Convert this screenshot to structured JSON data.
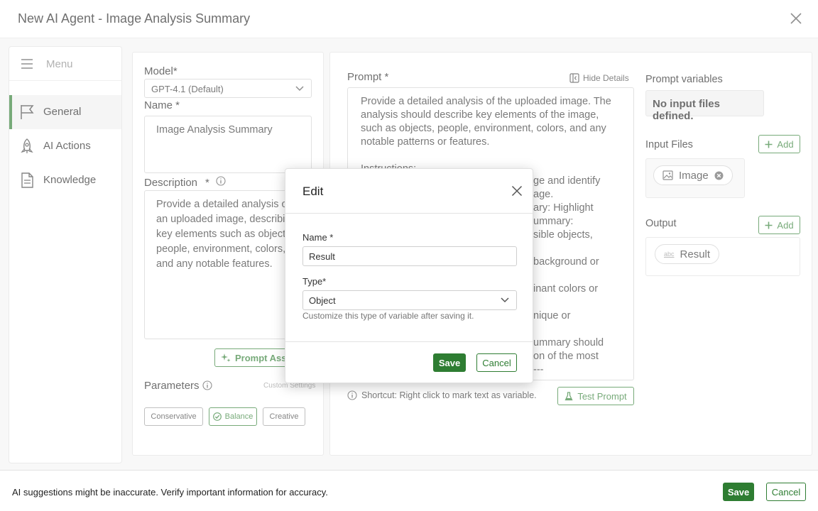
{
  "window": {
    "title": "New AI Agent - Image Analysis Summary"
  },
  "menu": {
    "label": "Menu",
    "items": [
      {
        "label": "General",
        "active": true
      },
      {
        "label": "AI Actions",
        "active": false
      },
      {
        "label": "Knowledge",
        "active": false
      }
    ]
  },
  "general": {
    "model_label": "Model*",
    "model_value": "GPT-4.1 (Default)",
    "name_label": "Name *",
    "name_value": "Image Analysis Summary",
    "description_label": "Description",
    "description_required": "*",
    "description_value": "Provide a detailed analysis of an uploaded image, describing key elements such as objects, people, environment, colors, and any notable features.",
    "prompt_assist_label": "Prompt Assi",
    "parameters_label": "Parameters",
    "custom_settings_label": "Custom Settings",
    "presets": [
      {
        "label": "Conservative",
        "selected": false
      },
      {
        "label": "Balance",
        "selected": true
      },
      {
        "label": "Creative",
        "selected": false
      }
    ]
  },
  "prompt": {
    "label": "Prompt *",
    "hide_details_label": "Hide Details",
    "paragraph1": "Provide a detailed analysis of the uploaded image. The analysis should describe key elements of the image, such as objects, people, environment, colors, and any notable patterns or features.",
    "instructions_heading": "Instructions:",
    "visible_fragments": [
      "ge and identify",
      "age.",
      "ary: Highlight",
      "ummary:",
      "sible objects,",
      "",
      "background or",
      "",
      "inant colors or",
      "",
      "nique or",
      "",
      "ummary should",
      "on of the most",
      "---"
    ],
    "shortcut_text": "Shortcut: Right click to mark text as variable.",
    "test_prompt_label": "Test Prompt"
  },
  "variables": {
    "label": "Prompt variables",
    "empty_text": "No input files defined."
  },
  "input_files": {
    "label": "Input Files",
    "add_label": "Add",
    "items": [
      {
        "label": "Image"
      }
    ]
  },
  "output": {
    "label": "Output",
    "add_label": "Add",
    "items": [
      {
        "label": "Result",
        "type_badge": "abc"
      }
    ]
  },
  "modal": {
    "title": "Edit",
    "name_label": "Name *",
    "name_value": "Result",
    "type_label": "Type*",
    "type_value": "Object",
    "hint": "Customize this type of variable after saving it.",
    "save_label": "Save",
    "cancel_label": "Cancel"
  },
  "footer": {
    "message": "AI suggestions might be inaccurate. Verify important information for accuracy.",
    "save_label": "Save",
    "cancel_label": "Cancel"
  },
  "colors": {
    "accent": "#2e7d32",
    "panel_bg": "#f4f4f4"
  }
}
